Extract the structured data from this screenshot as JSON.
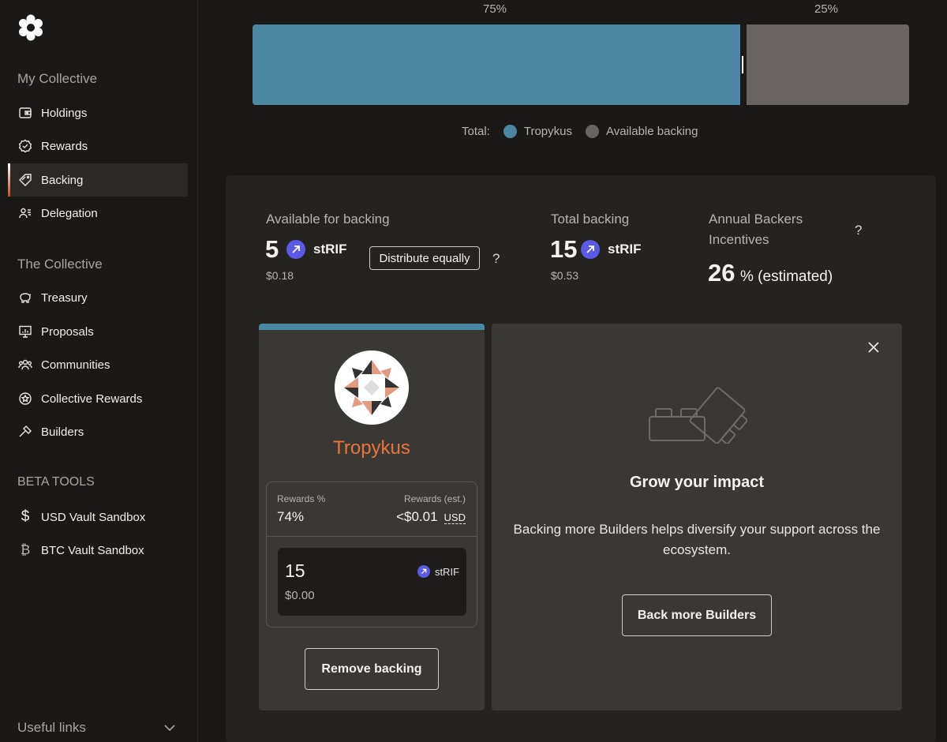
{
  "sidebar": {
    "logo_icon": "collective-gear-logo",
    "my_collective": {
      "title": "My Collective",
      "items": [
        {
          "label": "Holdings",
          "icon": "wallet-icon"
        },
        {
          "label": "Rewards",
          "icon": "badge-check-icon"
        },
        {
          "label": "Backing",
          "icon": "tag-icon",
          "active": true
        },
        {
          "label": "Delegation",
          "icon": "users-icon"
        }
      ]
    },
    "the_collective": {
      "title": "The Collective",
      "items": [
        {
          "label": "Treasury",
          "icon": "piggy-bank-icon"
        },
        {
          "label": "Proposals",
          "icon": "presentation-icon"
        },
        {
          "label": "Communities",
          "icon": "people-group-icon"
        },
        {
          "label": "Collective Rewards",
          "icon": "star-badge-icon"
        },
        {
          "label": "Builders",
          "icon": "hammer-icon"
        }
      ]
    },
    "beta_tools": {
      "title": "BETA TOOLS",
      "items": [
        {
          "label": "USD Vault Sandbox",
          "icon": "dollar-icon"
        },
        {
          "label": "BTC Vault Sandbox",
          "icon": "bitcoin-icon"
        }
      ]
    },
    "useful_links": "Useful links"
  },
  "allocation": {
    "left_pct_label": "75%",
    "right_pct_label": "25%",
    "tropykus_share": 0.75,
    "available_share": 0.25,
    "legend_total": "Total:",
    "legend_items": [
      {
        "label": "Tropykus",
        "color": "#4b87a3"
      },
      {
        "label": "Available backing",
        "color": "#696461"
      }
    ]
  },
  "stats": {
    "available": {
      "label": "Available for backing",
      "amount": "5",
      "token": "stRIF",
      "usd": "$0.18"
    },
    "distribute_label": "Distribute equally",
    "total": {
      "label": "Total backing",
      "amount": "15",
      "token": "stRIF",
      "usd": "$0.53"
    },
    "incentives": {
      "label_line1": "Annual Backers",
      "label_line2": "Incentives",
      "value": "26",
      "suffix": "% (estimated)"
    },
    "help": "?"
  },
  "builder_card": {
    "name": "Tropykus",
    "rewards_pct_label": "Rewards %",
    "rewards_pct_value": "74%",
    "rewards_est_label": "Rewards (est.)",
    "rewards_est_value": "<$0.01",
    "rewards_est_unit": "USD",
    "backing_amount": "15",
    "backing_token": "stRIF",
    "backing_usd": "$0.00",
    "remove_label": "Remove backing"
  },
  "grow_card": {
    "title": "Grow your impact",
    "text": "Backing more Builders helps diversify your support across the ecosystem.",
    "button_label": "Back more Builders",
    "close_icon": "close-icon"
  },
  "colors": {
    "accent_blue": "#4b87a3",
    "accent_orange": "#e8763a",
    "token_purple": "#5a5ae6"
  }
}
